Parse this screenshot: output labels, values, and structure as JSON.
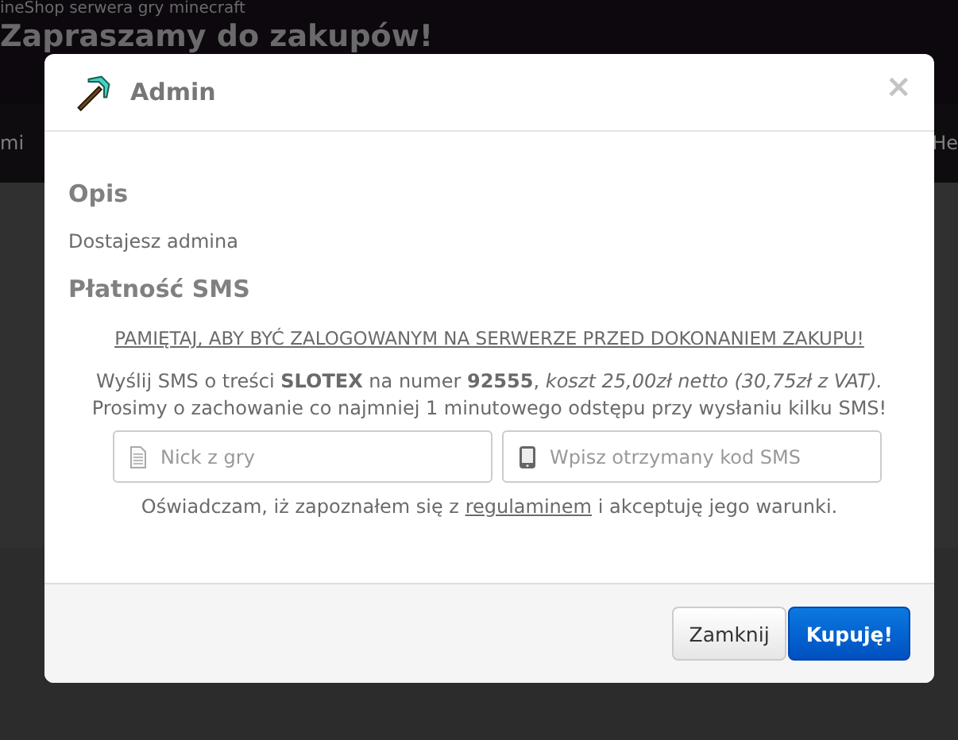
{
  "background": {
    "tagline": "ineShop serwera gry minecraft",
    "title": "Zapraszamy do zakupów!",
    "nav_items": [
      "mi",
      "He"
    ]
  },
  "modal": {
    "title": "Admin",
    "close": "×",
    "description_heading": "Opis",
    "description": "Dostajesz admina",
    "payment_heading": "Płatność SMS",
    "warning": "PAMIĘTAJ, ABY BYĆ ZALOGOWANYM NA SERWERZE PRZED DOKONANIEM ZAKUPU!",
    "sms_instruction": "Wyślij SMS o treści **SLOTEX** na numer **92555**, *koszt 25,00zł netto (30,75zł z VAT).*",
    "sms_note": "Prosimy o zachowanie co najmniej 1 minutowego odstępu przy wysłaniu kilku SMS!",
    "fields": [
      {
        "kind": "document",
        "placeholder": "Nick z gry"
      },
      {
        "kind": "phone",
        "placeholder": "Wpisz otrzymany kod SMS"
      }
    ],
    "terms_before": "Oświadczam, iż zapoznałem się z",
    "terms_link": "regulaminem",
    "terms_after": "i akceptuję jego warunki.",
    "buttons": [
      {
        "kind": "default",
        "label": "Zamknij"
      },
      {
        "kind": "primary",
        "label": "Kupuję!"
      }
    ]
  }
}
